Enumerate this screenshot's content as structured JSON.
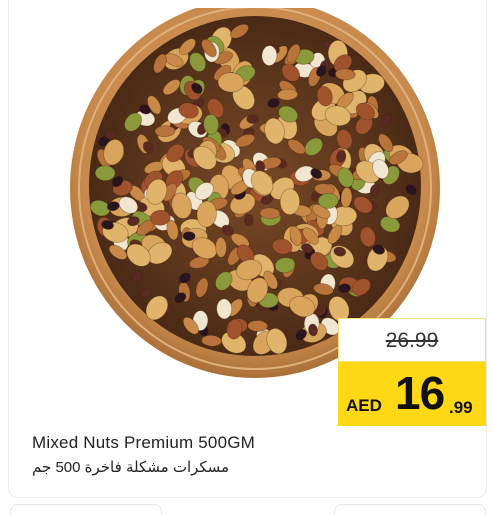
{
  "product": {
    "name_en": "Mixed Nuts Premium 500GM",
    "name_ar": "مسكرات مشكلة فاخرة 500 جم",
    "image_icon": "mixed-nuts-bowl-image"
  },
  "price": {
    "old": "26.99",
    "currency": "AED",
    "integer": "16",
    "decimal": ".99"
  },
  "colors": {
    "price_tag": "#ffd815",
    "bowl": "#c98b4e",
    "bowl_inner": "#b97a3e"
  }
}
